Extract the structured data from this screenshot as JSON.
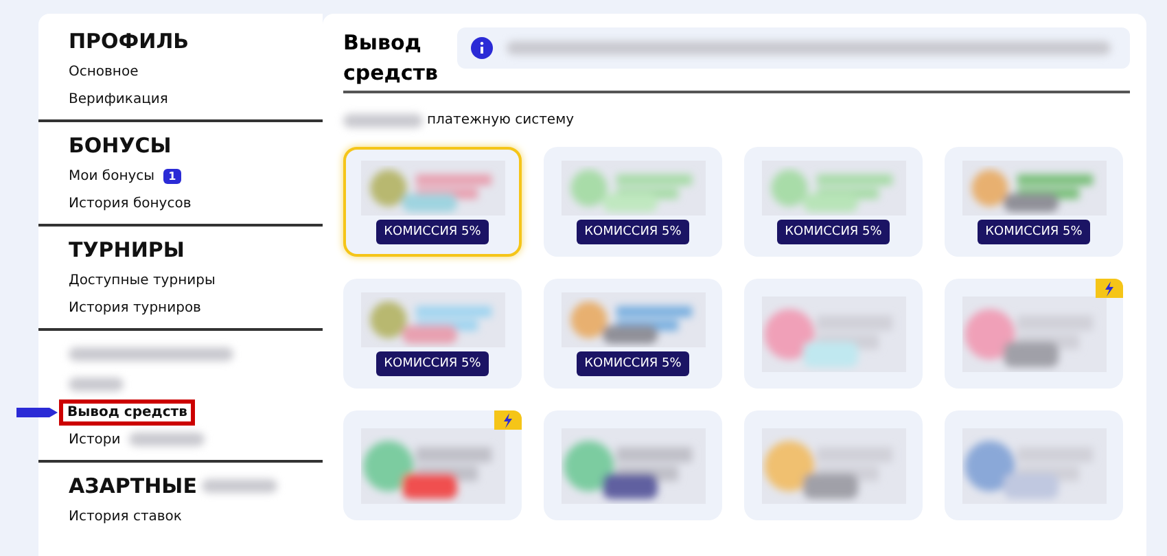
{
  "sidebar": {
    "sections": [
      {
        "title": "ПРОФИЛЬ",
        "items": [
          {
            "label": "Основное",
            "selected": false
          },
          {
            "label": "Верификация",
            "selected": false
          }
        ]
      },
      {
        "title": "БОНУСЫ",
        "items": [
          {
            "label": "Мои бонусы",
            "badge": "1",
            "selected": false
          },
          {
            "label": "История бонусов",
            "selected": false
          }
        ]
      },
      {
        "title": "ТУРНИРЫ",
        "items": [
          {
            "label": "Доступные турниры",
            "selected": false
          },
          {
            "label": "История турниров",
            "selected": false
          }
        ]
      },
      {
        "title_blurred": true,
        "items": [
          {
            "tail_blurred": true
          },
          {
            "label": "Вывод средств",
            "selected": true
          },
          {
            "label": "Истори",
            "selected": false,
            "tail_blurred": true
          }
        ]
      },
      {
        "title": "АЗАРТНЫЕ",
        "title_blurred": true,
        "items": [
          {
            "label": "История ставок",
            "selected": false
          }
        ]
      }
    ]
  },
  "main": {
    "title": "Вывод средств",
    "step_label": "платежную систему",
    "cards": [
      {
        "selected": true,
        "commission": "КОМИССИЯ 5%",
        "fast": false
      },
      {
        "selected": false,
        "commission": "КОМИССИЯ 5%",
        "fast": false
      },
      {
        "selected": false,
        "commission": "КОМИССИЯ 5%",
        "fast": false
      },
      {
        "selected": false,
        "commission": "КОМИССИЯ 5%",
        "fast": false
      },
      {
        "selected": false,
        "commission": "КОМИССИЯ 5%",
        "fast": false
      },
      {
        "selected": false,
        "commission": "КОМИССИЯ 5%",
        "fast": false
      },
      {
        "selected": false,
        "fast": false
      },
      {
        "selected": false,
        "fast": true
      },
      {
        "selected": false,
        "fast": true
      },
      {
        "selected": false,
        "fast": false
      },
      {
        "selected": false,
        "fast": false
      },
      {
        "selected": false,
        "fast": false
      }
    ]
  }
}
